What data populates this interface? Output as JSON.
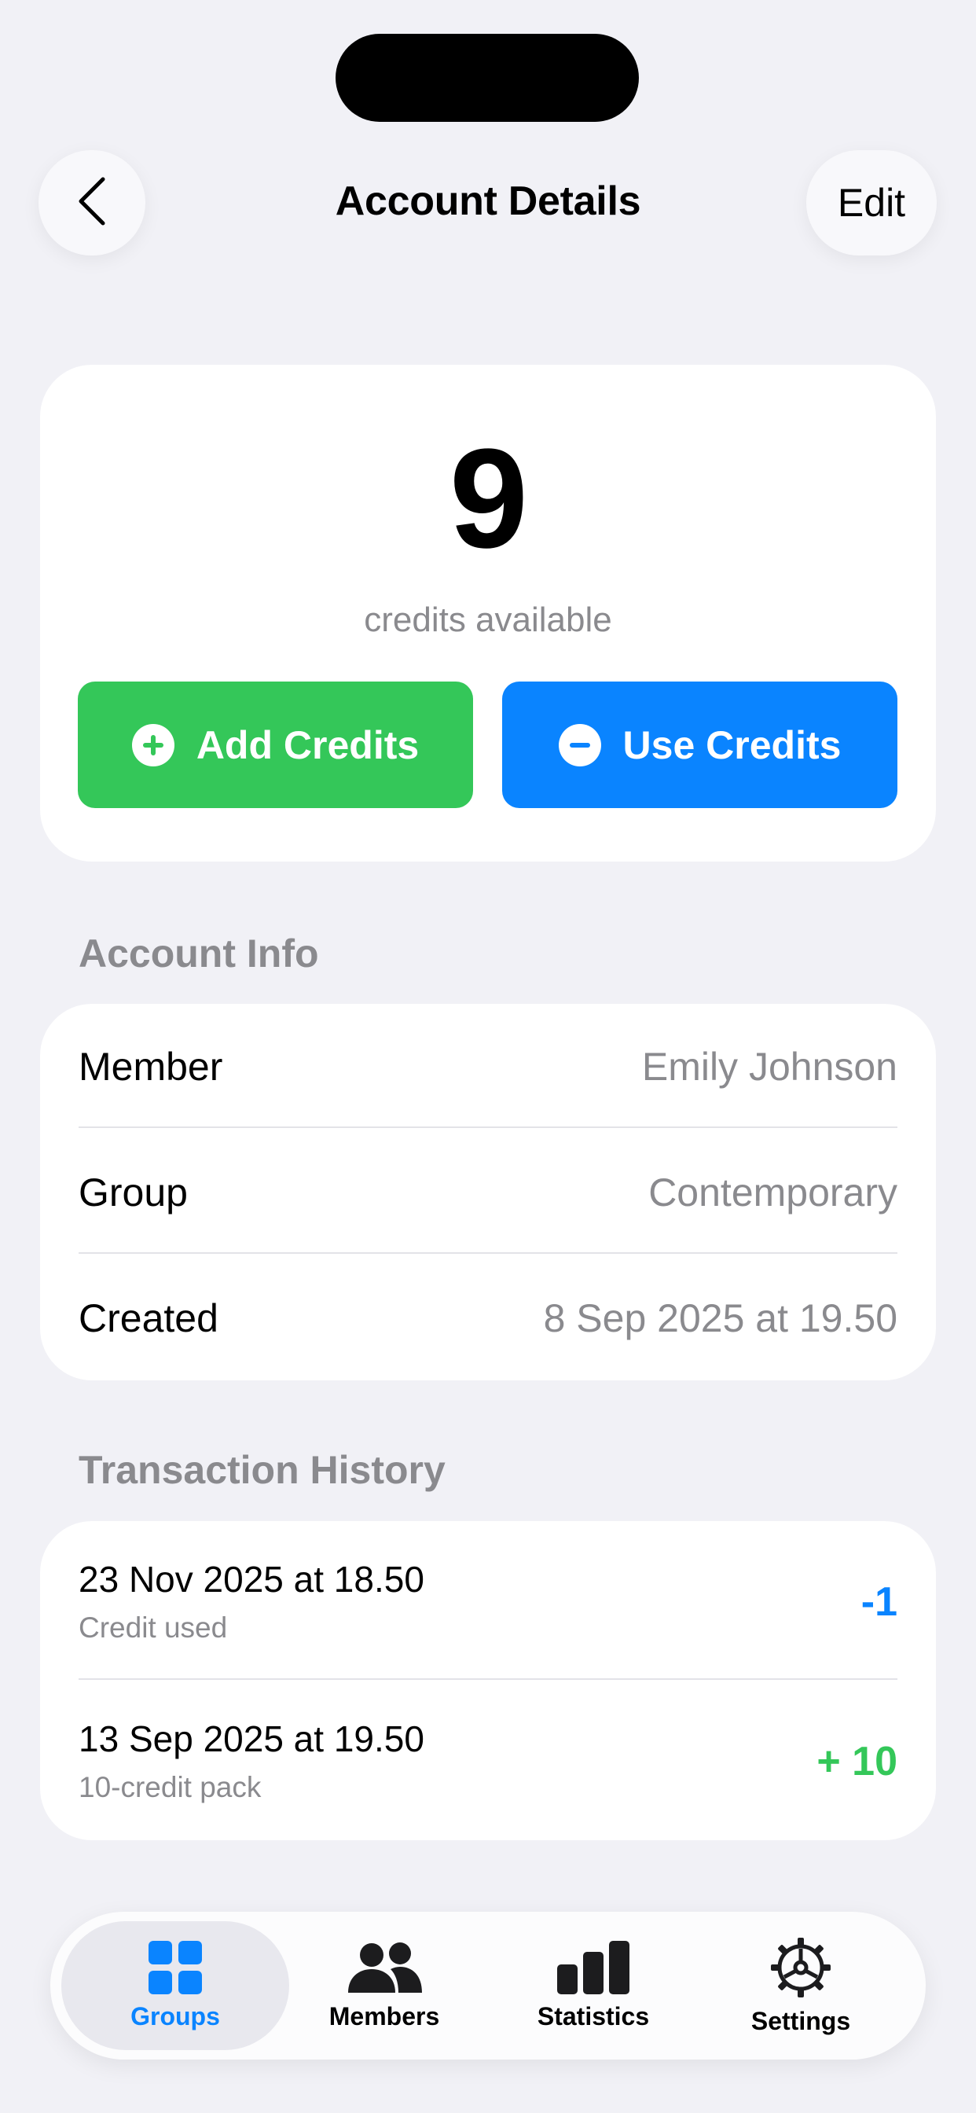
{
  "header": {
    "title": "Account Details",
    "edit_label": "Edit"
  },
  "credits": {
    "available": "9",
    "caption": "credits available",
    "add_label": "Add Credits",
    "use_label": "Use Credits"
  },
  "account_info": {
    "section_title": "Account Info",
    "rows": [
      {
        "label": "Member",
        "value": "Emily Johnson"
      },
      {
        "label": "Group",
        "value": "Contemporary"
      },
      {
        "label": "Created",
        "value": "8 Sep 2025 at 19.50"
      }
    ]
  },
  "transaction_history": {
    "section_title": "Transaction History",
    "items": [
      {
        "date": "23 Nov 2025 at 18.50",
        "description": "Credit used",
        "amount": "-1"
      },
      {
        "date": "13 Sep 2025 at 19.50",
        "description": "10-credit pack",
        "amount": "+ 10"
      }
    ]
  },
  "tabbar": {
    "tabs": [
      {
        "label": "Groups",
        "icon": "grid-icon",
        "active": true
      },
      {
        "label": "Members",
        "icon": "people-icon",
        "active": false
      },
      {
        "label": "Statistics",
        "icon": "bar-chart-icon",
        "active": false
      },
      {
        "label": "Settings",
        "icon": "gear-icon",
        "active": false
      }
    ]
  },
  "colors": {
    "background": "#f1f1f6",
    "add_green": "#34c759",
    "use_blue": "#0a84ff",
    "secondary_text": "#8a8a8e"
  }
}
